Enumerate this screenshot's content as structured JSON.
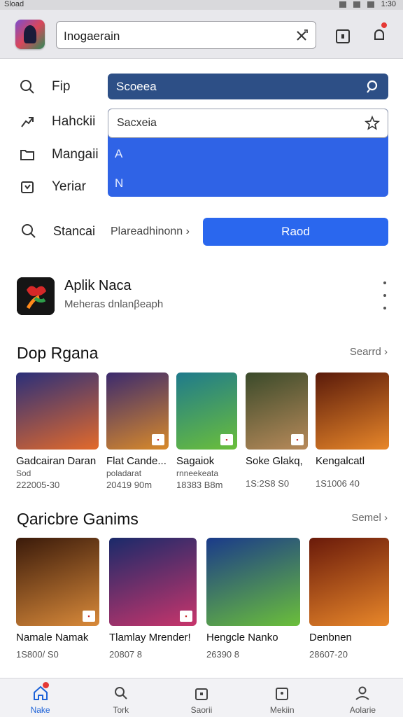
{
  "status": {
    "left": "Sload",
    "time": "1:30"
  },
  "topbar": {
    "search_value": "Inogaerain"
  },
  "menu": [
    {
      "label": "Fip",
      "icon": "search-icon"
    },
    {
      "label": "Hahckii",
      "icon": "share-arrow-icon"
    },
    {
      "label": "Mangaii",
      "icon": "folder-icon"
    },
    {
      "label": "Yeriar",
      "icon": "calendar-icon"
    }
  ],
  "dropdown": {
    "header": "Scoeea",
    "input_value": "Sacxeia",
    "options": [
      "A",
      "N"
    ]
  },
  "search_row": {
    "label": "Stancai",
    "crumb": "Plareadhinonn ›",
    "button": "Raod"
  },
  "featured": {
    "title": "Aplik Naca",
    "subtitle": "Meheras dnlanβeaph"
  },
  "sections": [
    {
      "title": "Dop Rgana",
      "see_all": "Searrd ›",
      "items": [
        {
          "name": "Gadcairan Daran",
          "meta": "Sod",
          "size": "222005-30",
          "art": [
            "#2a2f7a",
            "#e36a2b"
          ]
        },
        {
          "name": "Flat Cande...",
          "meta": "poladarat",
          "size": "20419 90m",
          "art": [
            "#3b2a6e",
            "#d98a2a"
          ]
        },
        {
          "name": "Sagaiok",
          "meta": "rnneekeata",
          "size": "18383 B8m",
          "art": [
            "#1f7a8c",
            "#6bbf3a"
          ]
        },
        {
          "name": "Soke Glakq,",
          "meta": "",
          "size": "1S:2S8 S0",
          "art": [
            "#3a4a2a",
            "#b88a5a"
          ]
        },
        {
          "name": "Kengalcatl",
          "meta": "",
          "size": "1S1006 40",
          "art": [
            "#5a1a0a",
            "#e8872a"
          ]
        }
      ]
    },
    {
      "title": "Qaricbre Ganims",
      "see_all": "Semel ›",
      "items": [
        {
          "name": "Namale Namak",
          "meta": "",
          "size": "1S800/ S0",
          "art": [
            "#3a1a0a",
            "#d98a3a"
          ]
        },
        {
          "name": "Tlamlay Mrender!",
          "meta": "",
          "size": "20807 8",
          "art": [
            "#1a2a6a",
            "#c8356b"
          ]
        },
        {
          "name": "Hengcle Nanko",
          "meta": "",
          "size": "26390 8",
          "art": [
            "#1a3a8a",
            "#6bbf3a"
          ]
        },
        {
          "name": "Denbnen",
          "meta": "",
          "size": "28607-20",
          "art": [
            "#6a1a0a",
            "#e8872a"
          ]
        }
      ]
    }
  ],
  "bottom_nav": [
    {
      "label": "Nake",
      "active": true
    },
    {
      "label": "Tork",
      "active": false
    },
    {
      "label": "Saorii",
      "active": false
    },
    {
      "label": "Mekiin",
      "active": false
    },
    {
      "label": "Aolarie",
      "active": false
    }
  ]
}
